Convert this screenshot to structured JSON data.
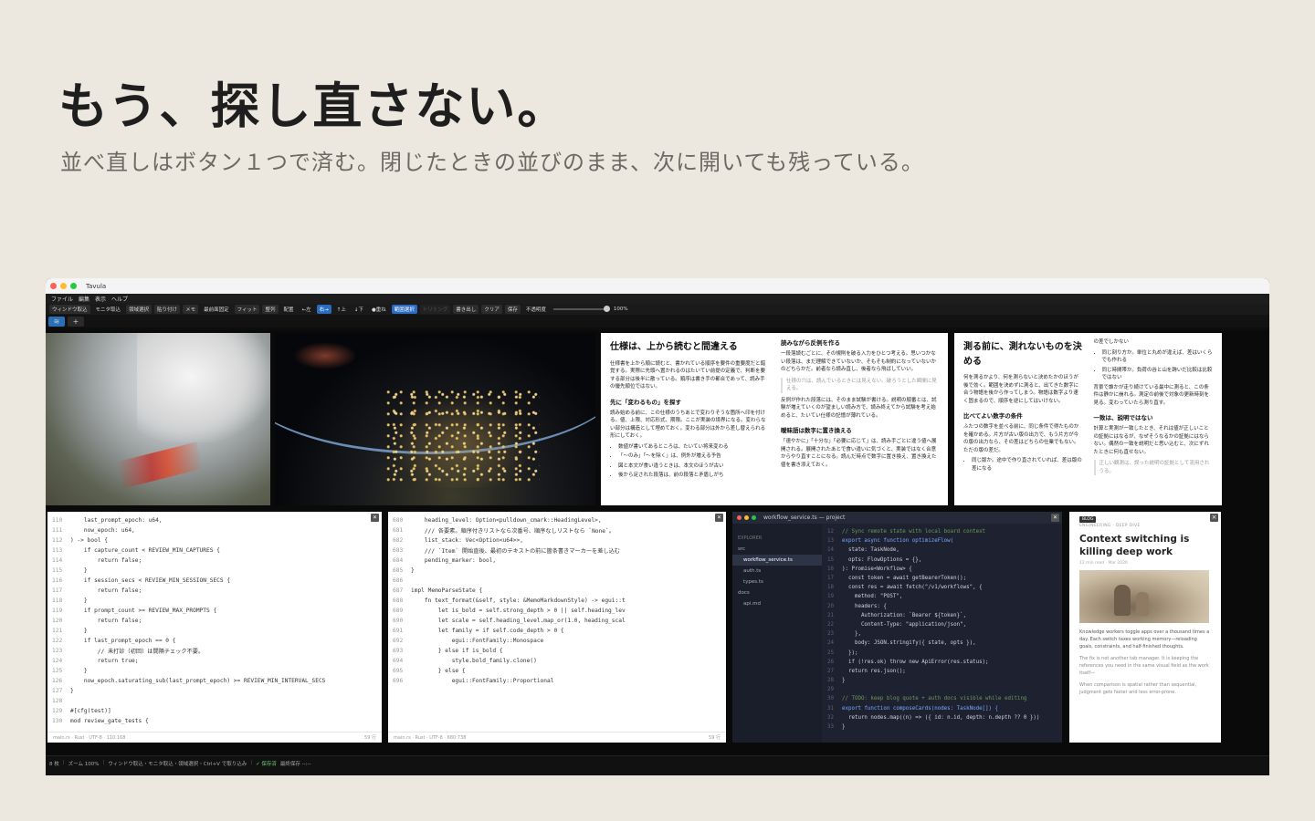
{
  "hero": {
    "title": "もう、探し直さない。",
    "subtitle": "並べ直しはボタン１つで済む。閉じたときの並びのまま、次に開いても残っている。"
  },
  "app": {
    "window_title": "Tavula",
    "traffic_colors": [
      "#ff5f57",
      "#febc2e",
      "#28c840"
    ],
    "menu": [
      "ファイル",
      "編集",
      "表示",
      "ヘルプ"
    ],
    "toolbar": [
      {
        "label": "ウィンドウ取込",
        "state": "normal"
      },
      {
        "label": "モニタ取込",
        "state": "plain"
      },
      {
        "label": "領域選択",
        "state": "normal"
      },
      {
        "label": "貼り付け",
        "state": "normal"
      },
      {
        "label": "メモ",
        "state": "normal"
      },
      {
        "label": "最前面固定",
        "state": "plain"
      },
      {
        "label": "フィット",
        "state": "normal"
      },
      {
        "label": "整列",
        "state": "normal"
      },
      {
        "label": "配置",
        "state": "plain"
      },
      {
        "label": "←左",
        "state": "plain"
      },
      {
        "label": "右→",
        "state": "active"
      },
      {
        "label": "↑上",
        "state": "plain"
      },
      {
        "label": "↓下",
        "state": "plain"
      },
      {
        "label": "●重ね",
        "state": "plain"
      },
      {
        "label": "範囲選択",
        "state": "active"
      },
      {
        "label": "トリミング",
        "state": "dim"
      },
      {
        "label": "書き出し",
        "state": "normal"
      },
      {
        "label": "クリア",
        "state": "normal"
      },
      {
        "label": "保存",
        "state": "normal"
      },
      {
        "label": "不透明度",
        "state": "plain"
      }
    ],
    "opacity": "100%",
    "accent": "#2a6cc1",
    "tabs": {
      "add": "+"
    },
    "status": {
      "count": "8 枚",
      "zoom": "ズーム 100%",
      "hint": "ウィンドウ取込・モニタ取込・領域選択・Ctrl+V で取り込み",
      "saved": "✓ 保存済",
      "last_saved": "最終保存 --:--"
    }
  },
  "doc1": {
    "h1": "仕様は、上から読むと間違える",
    "p1": "仕様書を上から順に読むと、書かれている順序を要件の重要度だと錯覚する。実際に先頭へ置かれるのはたいてい前提の定義で、判断を要する部分は後半に散っている。順序は書き手の都合であって、読み手の優先順位ではない。",
    "h2": "先に「変わるもの」を探す",
    "p2": "読み始める前に、この仕様のうちあとで変わりそうな箇所へ印を付ける。値、上限、対応形式、期限。ここが実装の境界になる。変わらない部分は構造として埋めておく。変わる部分は外から差し替えられる形にしておく。",
    "bullets": [
      "数値が書いてあるところは、たいてい将来変わる",
      "「〜のみ」「〜を除く」は、例外が増える予告",
      "図と本文が食い違うときは、本文のほうが古い",
      "後から足された段落は、前の段落と矛盾しがち"
    ],
    "h3": "読みながら反例を作る",
    "p3": "一段落読むごとに、その規則を破る入力をひとつ考える。思いつかない段落は、まだ理解できていないか、そもそも制約になっていないかのどちらかだ。前者なら読み直し、後者なら飛ばしていい。",
    "note": "仕様の穴は、読んでいるときには見えない。破ろうとした瞬間に見える。",
    "p4": "反例が作れた段落には、そのまま試験が書ける。説明の順番とは、試験が増えていくのが望ましい読み方で、読み終えてから試験を考え始めると、たいてい仕様の記憶が薄れている。",
    "h4": "曖昧語は数字に置き換える",
    "p5": "「速やかに」「十分な」「必要に応じて」は、読み手ごとに違う値へ展開される。展開されたあとで食い違いに気づくと、実装ではなく合意からやり直すことになる。読んだ時点で数字に置き換え、置き換えた値を書き添えておく。"
  },
  "doc2": {
    "h1": "測る前に、測れないものを決める",
    "p1": "何を測るかより、何を測らないと決めたかのほうが後で効く。範囲を決めずに測ると、出てきた数字に合う物語を後から作ってしまう。物語は数字より速く固まるので、順序を逆にしてはいけない。",
    "h2": "比べてよい数字の条件",
    "p2": "ふたつの数字を並べる前に、同じ条件で得たものかを確かめる。片方が古い版の出力で、もう片方が今の版の出力なら、その差はどちらの仕業でもない。ただの版の差だ。",
    "bullets1": [
      "同じ版か。途中で作り直されていれば、差は版の差になる"
    ],
    "top": "の差でしかない",
    "bullets2": [
      "同じ刻り方か。単位と丸めが違えば、差はいくらでも作れる",
      "同じ時間帯か。負荷の谷と山を跨いだ比較は比較ではない"
    ],
    "p3": "背景で誰かが走り続けている最中に測ると、この条件は静かに崩れる。測定の前後で対象の更新時刻を見る。変わっていたら測り直す。",
    "h3": "一致は、説明ではない",
    "p4": "計算と実測が一致したとき、それは値が正しいことの証拠にはなるが、なぜそうなるかの証拠にはならない。偶然の一致を説明だと思い込むと、次にずれたときに何も直せない。",
    "note": "正しい観測は、誤った説明の証拠として流用されうる。"
  },
  "code1": {
    "lines": [
      {
        "n": "110",
        "t": "    last_prompt_epoch: u64,"
      },
      {
        "n": "111",
        "t": "    now_epoch: u64,"
      },
      {
        "n": "112",
        "t": ") -> bool {"
      },
      {
        "n": "113",
        "t": "    if capture_count < REVIEW_MIN_CAPTURES {"
      },
      {
        "n": "114",
        "t": "        return false;"
      },
      {
        "n": "115",
        "t": "    }"
      },
      {
        "n": "116",
        "t": "    if session_secs < REVIEW_MIN_SESSION_SECS {"
      },
      {
        "n": "117",
        "t": "        return false;"
      },
      {
        "n": "118",
        "t": "    }"
      },
      {
        "n": "119",
        "t": "    if prompt_count >= REVIEW_MAX_PROMPTS {"
      },
      {
        "n": "120",
        "t": "        return false;"
      },
      {
        "n": "121",
        "t": "    }"
      },
      {
        "n": "122",
        "t": "    if last_prompt_epoch == 0 {"
      },
      {
        "n": "123",
        "t": "        // 未打診（初回）は間隔チェック不要。"
      },
      {
        "n": "124",
        "t": "        return true;"
      },
      {
        "n": "125",
        "t": "    }"
      },
      {
        "n": "126",
        "t": "    now_epoch.saturating_sub(last_prompt_epoch) >= REVIEW_MIN_INTERVAL_SECS"
      },
      {
        "n": "127",
        "t": "}"
      },
      {
        "n": "128",
        "t": ""
      },
      {
        "n": "129",
        "t": "#[cfg(test)]"
      },
      {
        "n": "130",
        "t": "mod review_gate_tests {"
      }
    ],
    "footer_left": "main.rs  ·  Rust  ·  UTF-8  ·  110:168",
    "footer_right": "59 行"
  },
  "code2": {
    "lines": [
      {
        "n": "680",
        "t": "    heading_level: Option<pulldown_cmark::HeadingLevel>,"
      },
      {
        "n": "681",
        "t": "    /// 各要素。順序付きリストなら次番号、順序なしリストなら `None`。"
      },
      {
        "n": "682",
        "t": "    list_stack: Vec<Option<u64>>,"
      },
      {
        "n": "683",
        "t": "    /// `Item` 開始直後、最初のテキストの前に箇条書きマーカーを差し込む"
      },
      {
        "n": "684",
        "t": "    pending_marker: bool,"
      },
      {
        "n": "685",
        "t": "}"
      },
      {
        "n": "686",
        "t": ""
      },
      {
        "n": "687",
        "t": "impl MemoParseState {"
      },
      {
        "n": "688",
        "t": "    fn text_format(&self, style: &MemoMarkdownStyle) -> egui::t"
      },
      {
        "n": "689",
        "t": "        let is_bold = self.strong_depth > 0 || self.heading_lev"
      },
      {
        "n": "690",
        "t": "        let scale = self.heading_level.map_or(1.0, heading_scal"
      },
      {
        "n": "691",
        "t": "        let family = if self.code_depth > 0 {"
      },
      {
        "n": "692",
        "t": "            egui::FontFamily::Monospace"
      },
      {
        "n": "693",
        "t": "        } else if is_bold {"
      },
      {
        "n": "694",
        "t": "            style.bold_family.clone()"
      },
      {
        "n": "695",
        "t": "        } else {"
      },
      {
        "n": "696",
        "t": "            egui::FontFamily::Proportional"
      }
    ],
    "footer_left": "main.rs  ·  Rust  ·  UTF-8  ·  680:738",
    "footer_right": "59 行"
  },
  "ide": {
    "title": "workflow_service.ts — project",
    "explorer_label": "EXPLORER",
    "tree": [
      {
        "label": "src",
        "selected": false
      },
      {
        "label": "workflow_service.ts",
        "selected": true
      },
      {
        "label": "auth.ts",
        "selected": false
      },
      {
        "label": "types.ts",
        "selected": false
      },
      {
        "label": "docs",
        "selected": false
      },
      {
        "label": "api.md",
        "selected": false
      }
    ],
    "lines": [
      {
        "n": "12",
        "t": "// Sync remote state with local board context",
        "k": "cmt"
      },
      {
        "n": "13",
        "t": "export async function optimizeFlow(",
        "k": "kw"
      },
      {
        "n": "14",
        "t": "  state: TaskNode,",
        "k": ""
      },
      {
        "n": "15",
        "t": "  opts: FlowOptions = {},",
        "k": ""
      },
      {
        "n": "16",
        "t": "): Promise<Workflow> {",
        "k": ""
      },
      {
        "n": "17",
        "t": "  const token = await getBearerToken();",
        "k": ""
      },
      {
        "n": "18",
        "t": "  const res = await fetch(\"/v1/workflows\", {",
        "k": ""
      },
      {
        "n": "19",
        "t": "    method: \"POST\",",
        "k": ""
      },
      {
        "n": "20",
        "t": "    headers: {",
        "k": ""
      },
      {
        "n": "21",
        "t": "      Authorization: `Bearer ${token}`,",
        "k": ""
      },
      {
        "n": "22",
        "t": "      Content-Type: \"application/json\",",
        "k": ""
      },
      {
        "n": "23",
        "t": "    },",
        "k": ""
      },
      {
        "n": "24",
        "t": "    body: JSON.stringify({ state, opts }),",
        "k": ""
      },
      {
        "n": "25",
        "t": "  });",
        "k": ""
      },
      {
        "n": "26",
        "t": "  if (!res.ok) throw new ApiError(res.status);",
        "k": ""
      },
      {
        "n": "27",
        "t": "  return res.json();",
        "k": ""
      },
      {
        "n": "28",
        "t": "}",
        "k": ""
      },
      {
        "n": "29",
        "t": "",
        "k": ""
      },
      {
        "n": "30",
        "t": "// TODO: keep blog quote + auth docs visible while editing",
        "k": "cmt"
      },
      {
        "n": "31",
        "t": "export function composeCards(nodes: TaskNode[]) {",
        "k": "kw"
      },
      {
        "n": "32",
        "t": "  return nodes.map((n) => ({ id: n.id, depth: n.depth ?? 0 }))",
        "k": ""
      },
      {
        "n": "33",
        "t": "}",
        "k": ""
      }
    ]
  },
  "blog": {
    "tag": "BLOG",
    "category": "ENGINEERING · DEEP DIVE",
    "title": "Context switching is killing deep work",
    "meta": "12 min read · Mar 2026",
    "p1": "Knowledge workers toggle apps over a thousand times a day. Each switch taxes working memory—reloading goals, constraints, and half-finished thoughts.",
    "p2": "The fix is not another tab manager. It is keeping the references you need in the same visual field as the work itself—",
    "p3": "When comparison is spatial rather than sequential, judgment gets faster and less error-prone."
  }
}
